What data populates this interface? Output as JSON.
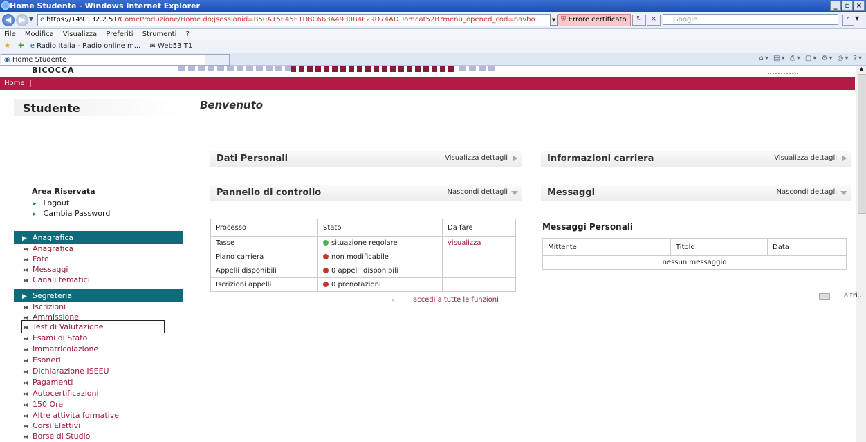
{
  "browser": {
    "window_title": "Home Studente - Windows Internet Explorer",
    "url_host": "https://149.132.2.51/",
    "url_path": "ComeProduzione/Home.do;jsessionid=B50A15E45E1D8C663A4930B4F29D74AD.Tomcat52B?menu_opened_cod=navbo",
    "cert_error": "Errore certificato",
    "search_placeholder": "Google",
    "menu": [
      "File",
      "Modifica",
      "Visualizza",
      "Preferiti",
      "Strumenti",
      "?"
    ],
    "favorites": [
      "Radio Italia - Radio online m...",
      "Web53 T1"
    ],
    "tab_title": "Home Studente"
  },
  "page": {
    "logo_text": "BICOCCA",
    "topnav_home": "Home",
    "sidebar_title": "Studente",
    "area_riservata": {
      "title": "Area Riservata",
      "links": [
        "Logout",
        "Cambia Password"
      ]
    },
    "sections": [
      {
        "title": "Anagrafica",
        "items": [
          "Anagrafica",
          "Foto",
          "Messaggi",
          "Canali tematici"
        ]
      },
      {
        "title": "Segreteria",
        "items": [
          "Iscrizioni",
          "Ammissione",
          "Test di Valutazione",
          "Esami di Stato",
          "Immatricolazione",
          "Esoneri",
          "Dichiarazione ISEEU",
          "Pagamenti",
          "Autocertificazioni",
          "150 Ore",
          "Altre attività formative",
          "Corsi Elettivi",
          "Borse di Studio"
        ]
      }
    ],
    "welcome": "Benvenuto",
    "panels": {
      "dati_personali": {
        "title": "Dati Personali",
        "action": "Visualizza dettagli"
      },
      "informazioni_carriera": {
        "title": "Informazioni carriera",
        "action": "Visualizza dettagli"
      },
      "pannello_controllo": {
        "title": "Pannello di controllo",
        "action": "Nascondi dettagli"
      },
      "messaggi": {
        "title": "Messaggi",
        "action": "Nascondi dettagli"
      }
    },
    "control_table": {
      "headers": [
        "Processo",
        "Stato",
        "Da fare"
      ],
      "rows": [
        {
          "processo": "Tasse",
          "stato": "situazione regolare",
          "status": "green",
          "da_fare": "visualizza"
        },
        {
          "processo": "Piano carriera",
          "stato": "non modificabile",
          "status": "red",
          "da_fare": ""
        },
        {
          "processo": "Appelli disponibili",
          "stato": "0 appelli disponibili",
          "status": "red",
          "da_fare": ""
        },
        {
          "processo": "Iscrizioni appelli",
          "stato": "0 prenotazioni",
          "status": "red",
          "da_fare": ""
        }
      ]
    },
    "accedi_link": "accedi a tutte le funzioni",
    "messaggi_personali": {
      "title": "Messaggi Personali",
      "headers": [
        "Mittente",
        "Titolo",
        "Data"
      ],
      "empty": "nessun messaggio",
      "more": "altri..."
    }
  }
}
